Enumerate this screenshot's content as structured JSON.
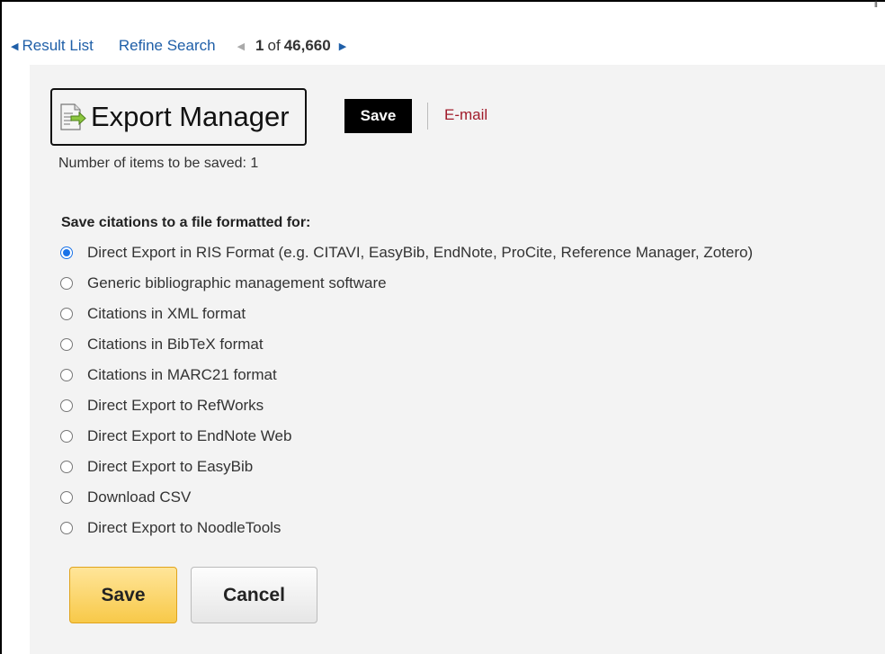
{
  "nav": {
    "result_list": "Result List",
    "refine_search": "Refine Search",
    "position": "1",
    "of_label": "of",
    "total": "46,660"
  },
  "manager": {
    "title": "Export Manager",
    "save_label": "Save",
    "email_label": "E-mail",
    "items_to_save": "Number of items to be saved: 1",
    "section_label": "Save citations to a file formatted for:",
    "options": [
      {
        "label": "Direct Export in RIS Format (e.g. CITAVI, EasyBib, EndNote, ProCite, Reference Manager, Zotero)",
        "checked": true
      },
      {
        "label": "Generic bibliographic management software",
        "checked": false
      },
      {
        "label": "Citations in XML format",
        "checked": false
      },
      {
        "label": "Citations in BibTeX format",
        "checked": false
      },
      {
        "label": "Citations in MARC21 format",
        "checked": false
      },
      {
        "label": "Direct Export to RefWorks",
        "checked": false
      },
      {
        "label": "Direct Export to EndNote Web",
        "checked": false
      },
      {
        "label": "Direct Export to EasyBib",
        "checked": false
      },
      {
        "label": "Download CSV",
        "checked": false
      },
      {
        "label": "Direct Export to NoodleTools",
        "checked": false
      }
    ],
    "save_button": "Save",
    "cancel_button": "Cancel"
  },
  "colors": {
    "link": "#1f5fa8",
    "email": "#a11c2b",
    "radio_selected": "#1a73e8",
    "save_button": "#f8c949"
  },
  "icons": [
    "left-triangle-icon",
    "right-triangle-icon",
    "export-document-icon"
  ]
}
